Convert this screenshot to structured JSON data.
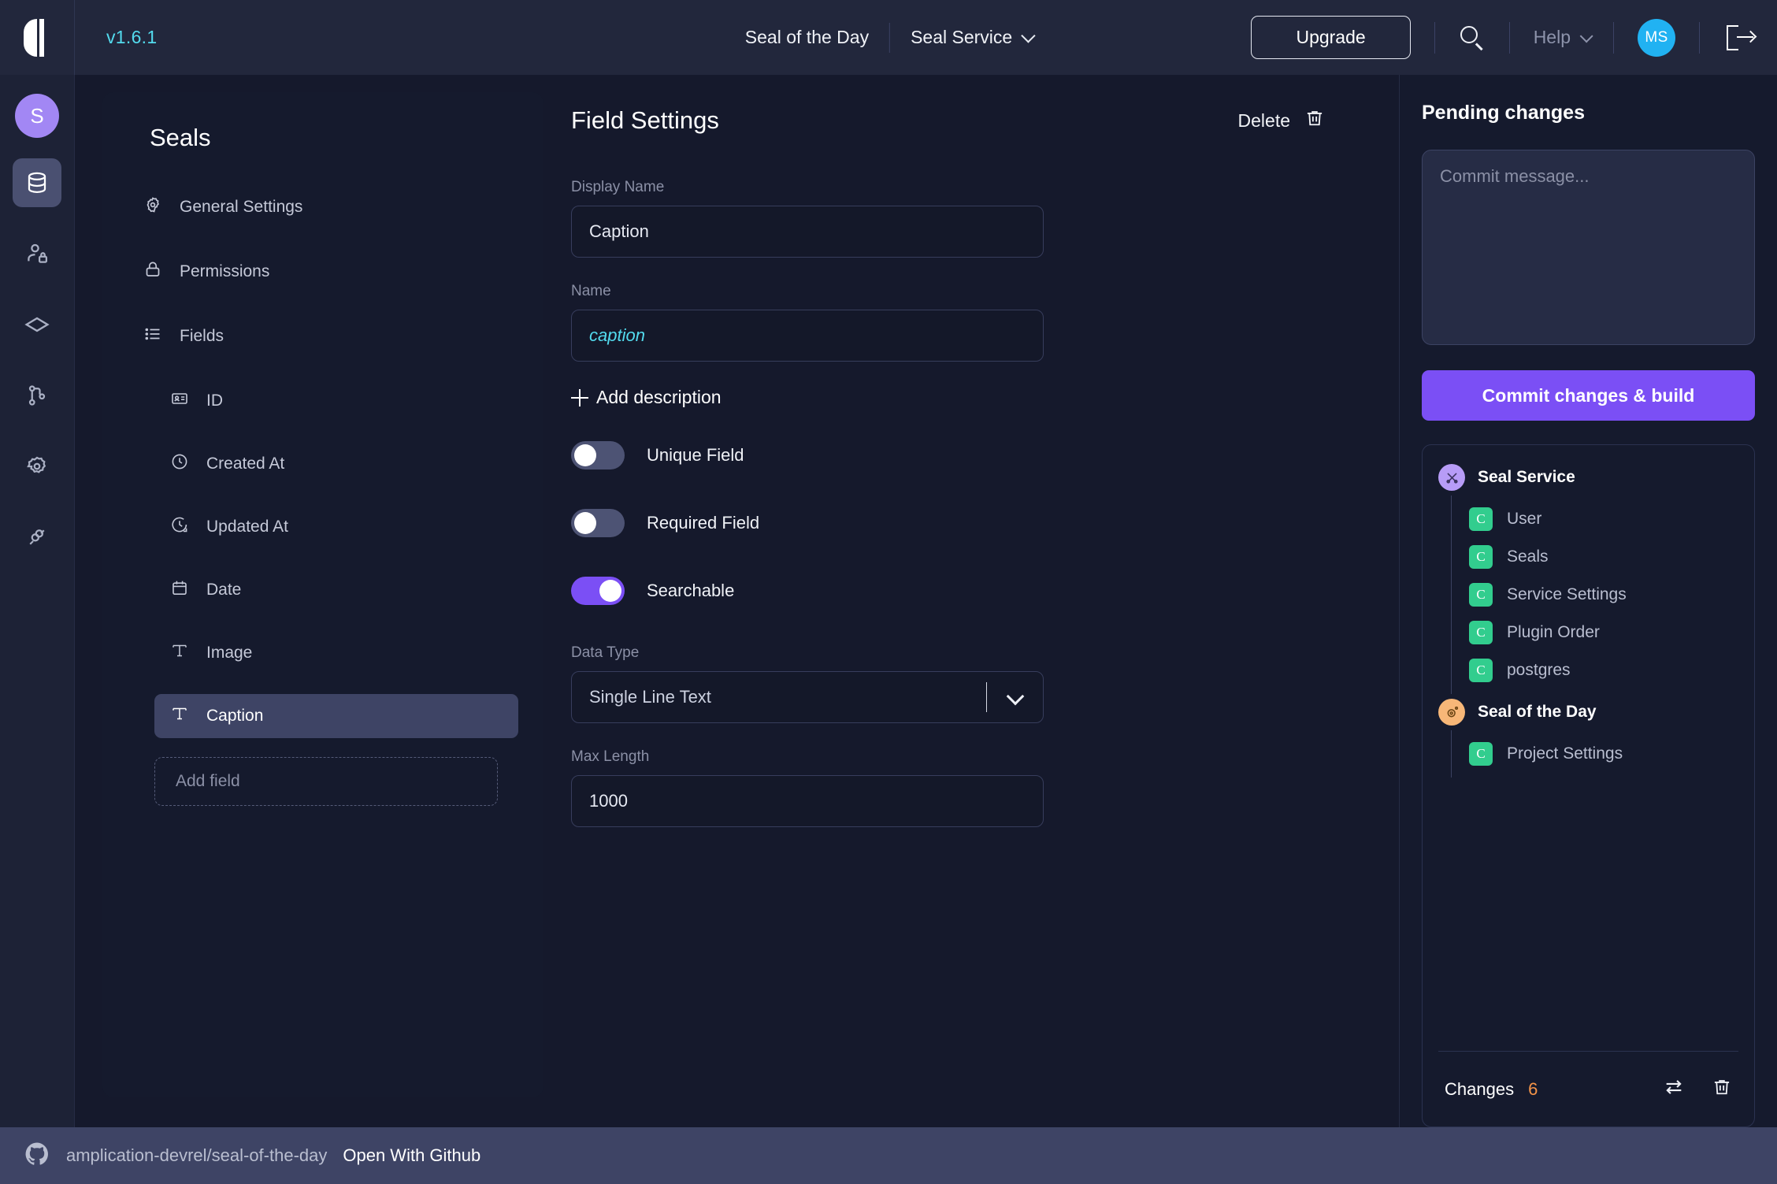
{
  "topbar": {
    "logo_icon": "amplication-logo",
    "version": "v1.6.1",
    "project_name": "Seal of the Day",
    "service_name": "Seal Service",
    "service_chevron_icon": "chevron-down-icon",
    "upgrade_label": "Upgrade",
    "search_icon": "search-icon",
    "help_label": "Help",
    "help_chevron_icon": "chevron-down-icon",
    "avatar_initials": "MS",
    "logout_icon": "logout-icon"
  },
  "rail": {
    "avatar_initial": "S",
    "items": [
      {
        "icon": "database-icon",
        "active": true
      },
      {
        "icon": "user-lock-icon",
        "active": false
      },
      {
        "icon": "entity-diamond-icon",
        "active": false
      },
      {
        "icon": "git-branch-icon",
        "active": false
      },
      {
        "icon": "settings-gear-icon",
        "active": false
      },
      {
        "icon": "plugins-icon",
        "active": false
      }
    ]
  },
  "entity_panel": {
    "title": "Seals",
    "nav": [
      {
        "label": "General Settings",
        "icon": "gear-icon"
      },
      {
        "label": "Permissions",
        "icon": "lock-icon"
      },
      {
        "label": "Fields",
        "icon": "list-icon"
      }
    ],
    "fields": [
      {
        "label": "ID",
        "icon": "id-card-icon",
        "selected": false
      },
      {
        "label": "Created At",
        "icon": "clock-icon",
        "selected": false
      },
      {
        "label": "Updated At",
        "icon": "clock-refresh-icon",
        "selected": false
      },
      {
        "label": "Date",
        "icon": "calendar-icon",
        "selected": false
      },
      {
        "label": "Image",
        "icon": "text-t-icon",
        "selected": false
      },
      {
        "label": "Caption",
        "icon": "text-t-icon",
        "selected": true
      }
    ],
    "add_field_label": "Add field"
  },
  "field_settings": {
    "title": "Field Settings",
    "delete_label": "Delete",
    "delete_icon": "trash-icon",
    "display_name_label": "Display Name",
    "display_name_value": "Caption",
    "display_name_placeholder": "Display Name",
    "name_label": "Name",
    "name_value": "caption",
    "name_placeholder": "Name",
    "add_description_label": "Add description",
    "toggles": [
      {
        "label": "Unique Field",
        "on": false
      },
      {
        "label": "Required Field",
        "on": false
      },
      {
        "label": "Searchable",
        "on": true
      }
    ],
    "data_type_label": "Data Type",
    "data_type_value": "Single Line Text",
    "data_type_chevron_icon": "chevron-down-icon",
    "max_length_label": "Max Length",
    "max_length_value": "1000",
    "max_length_placeholder": "Max Length"
  },
  "pending": {
    "title": "Pending changes",
    "commit_placeholder": "Commit message...",
    "commit_value": "",
    "commit_button_label": "Commit changes & build",
    "groups": [
      {
        "label": "Seal Service",
        "badge_icon": "service-tools-icon",
        "badge_color": "#b79cf7",
        "items": [
          {
            "badge": "C",
            "label": "User"
          },
          {
            "badge": "C",
            "label": "Seals"
          },
          {
            "badge": "C",
            "label": "Service Settings"
          },
          {
            "badge": "C",
            "label": "Plugin Order"
          },
          {
            "badge": "C",
            "label": "postgres"
          }
        ]
      },
      {
        "label": "Seal of the Day",
        "badge_icon": "project-gear-icon",
        "badge_color": "#f7b778",
        "items": [
          {
            "badge": "C",
            "label": "Project Settings"
          }
        ]
      }
    ],
    "changes_label": "Changes",
    "changes_count": "6",
    "compare_icon": "compare-arrows-icon",
    "discard_icon": "trash-icon"
  },
  "statusbar": {
    "github_icon": "github-icon",
    "repo": "amplication-devrel/seal-of-the-day",
    "open_label": "Open With Github"
  },
  "colors": {
    "accent_purple": "#7b4ff5",
    "accent_cyan": "#53dbee",
    "accent_green": "#32cd8e",
    "accent_orange": "#f59448",
    "avatar_blue": "#21b2f2"
  }
}
